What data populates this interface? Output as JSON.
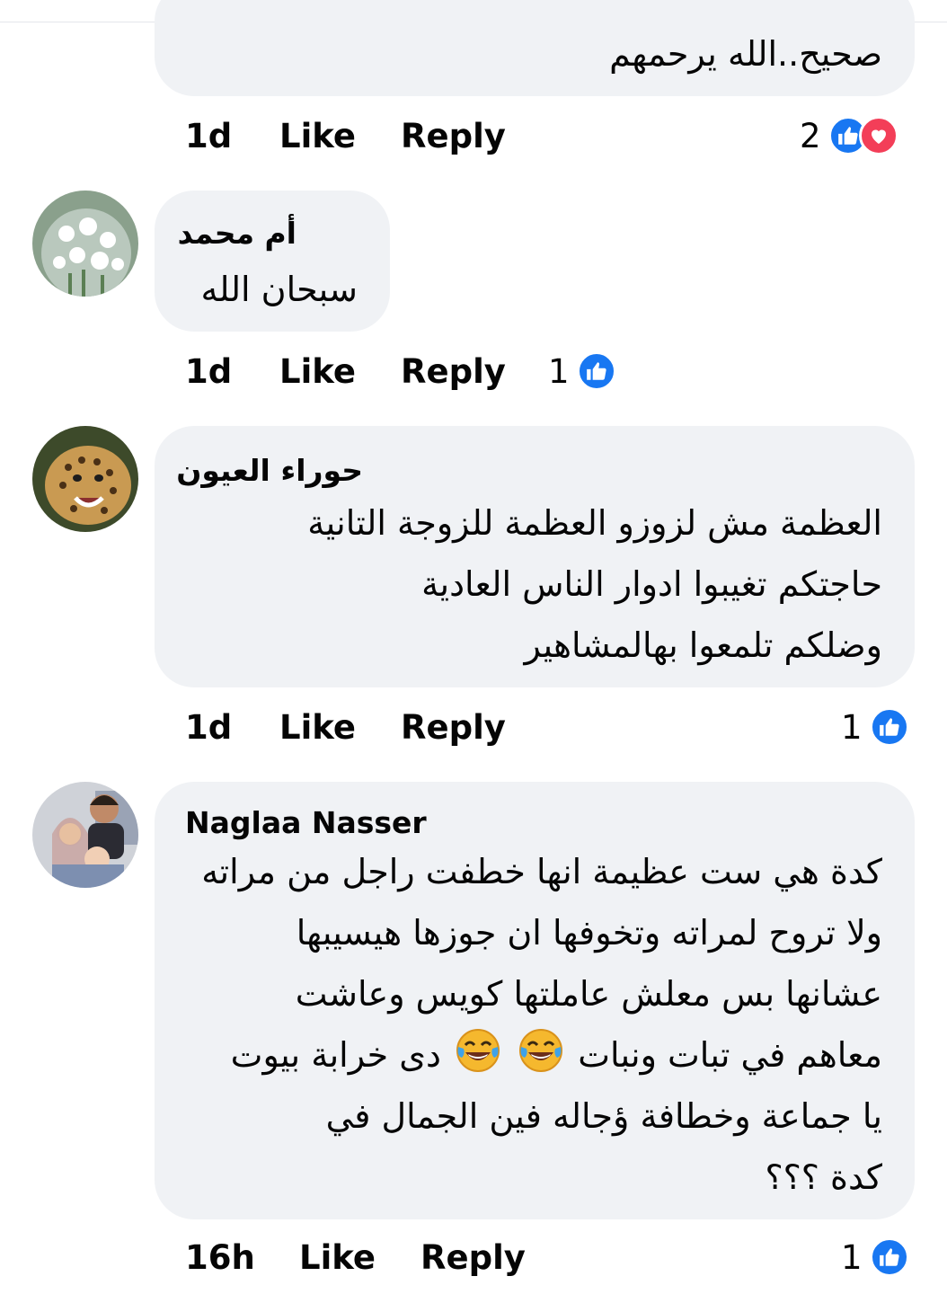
{
  "comments": [
    {
      "author": "",
      "lines": [
        "صحيح..الله يرحمهم"
      ],
      "time": "1d",
      "like_label": "Like",
      "reply_label": "Reply",
      "reaction_count": "2",
      "reactions": [
        "like-icon",
        "love-icon"
      ]
    },
    {
      "author": "أم محمد",
      "lines": [
        "سبحان الله"
      ],
      "time": "1d",
      "like_label": "Like",
      "reply_label": "Reply",
      "reaction_count": "1",
      "reactions": [
        "like-icon"
      ]
    },
    {
      "author": "حوراء العيون",
      "lines": [
        "العظمة مش لزوزو العظمة للزوجة التانية",
        "حاجتكم تغيبوا ادوار الناس العادية",
        "وضلكم تلمعوا بهالمشاهير"
      ],
      "time": "1d",
      "like_label": "Like",
      "reply_label": "Reply",
      "reaction_count": "1",
      "reactions": [
        "like-icon"
      ]
    },
    {
      "author": "Naglaa Nasser",
      "lines": [
        "كدة هي ست عظيمة انها خطفت راجل من مراته",
        "ولا تروح لمراته وتخوفها ان جوزها هيسيبها",
        "عشانها بس معلش عاملتها كويس وعاشت",
        "معاهم في تبات ونبات",
        "دى خرابة بيوت",
        "يا جماعة وخطافة ؤجاله فين الجمال في",
        "كدة ؟؟؟"
      ],
      "emoji": [
        "face-with-tears-of-joy-icon",
        "face-with-tears-of-joy-icon"
      ],
      "time": "16h",
      "like_label": "Like",
      "reply_label": "Reply",
      "reaction_count": "1",
      "reactions": [
        "like-icon"
      ]
    }
  ],
  "colors": {
    "bubble": "#f0f2f5",
    "like_blue": "#1877f2",
    "love_red": "#f33e58",
    "text": "#050505"
  }
}
